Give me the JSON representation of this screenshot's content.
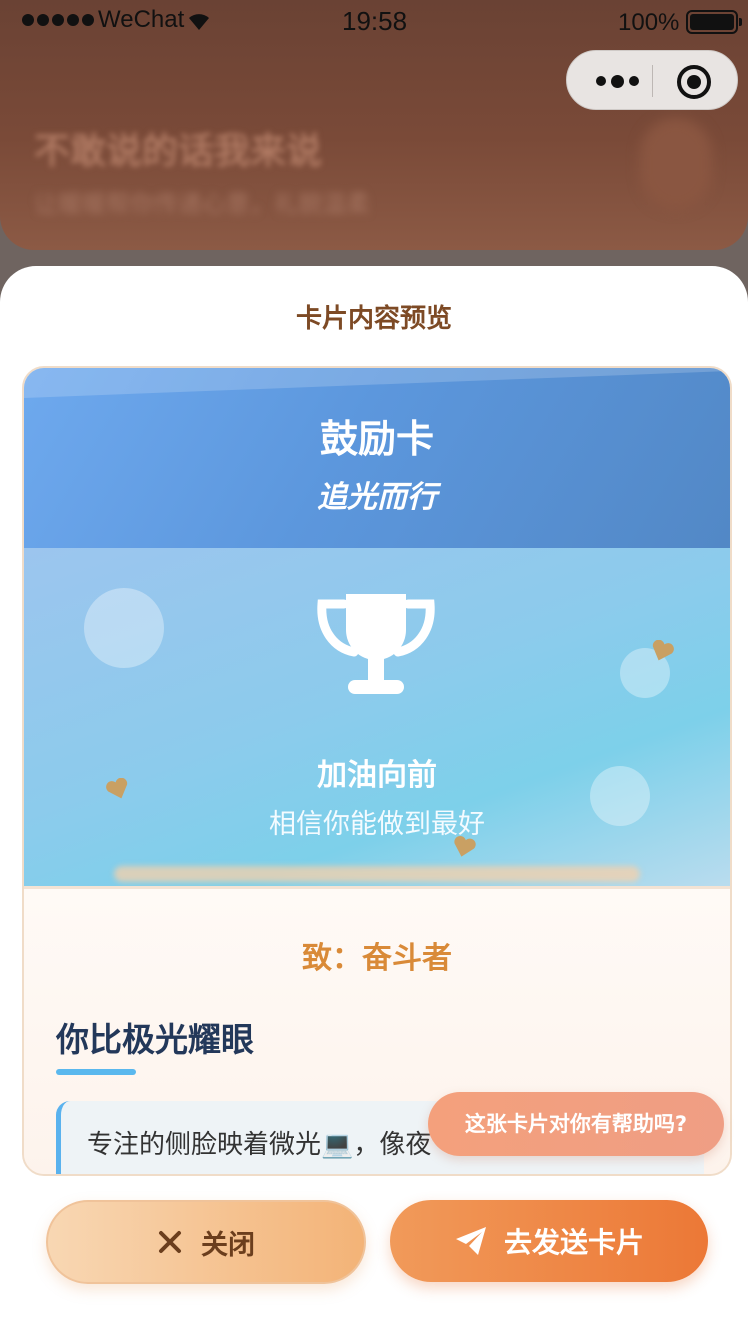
{
  "status_bar": {
    "carrier": "WeChat",
    "time": "19:58",
    "battery": "100%"
  },
  "background": {
    "title": "不敢说的话我来说",
    "subtitle": "让暖暖帮你传递心意，礼貌温柔"
  },
  "sheet": {
    "title": "卡片内容预览"
  },
  "card": {
    "title": "鼓励卡",
    "subtitle": "追光而行",
    "scene_text": "加油向前",
    "scene_subtext": "相信你能做到最好",
    "recipient": "致：奋斗者",
    "headline": "你比极光耀眼",
    "quote_line1": "专注的侧脸映着微光💻，像夜"
  },
  "toast": {
    "label": "这张卡片对你有帮助吗?"
  },
  "actions": {
    "close_label": "关闭",
    "send_label": "去发送卡片"
  },
  "colors": {
    "accent_orange": "#ec7836",
    "header_blue": "#5c97dd",
    "headline_navy": "#23385a",
    "recipient_orange": "#d98a38"
  },
  "icons": {
    "close": "close-icon",
    "send": "paper-plane-icon",
    "trophy": "trophy-icon",
    "more": "more-dots-icon",
    "capsule_close": "target-icon"
  }
}
